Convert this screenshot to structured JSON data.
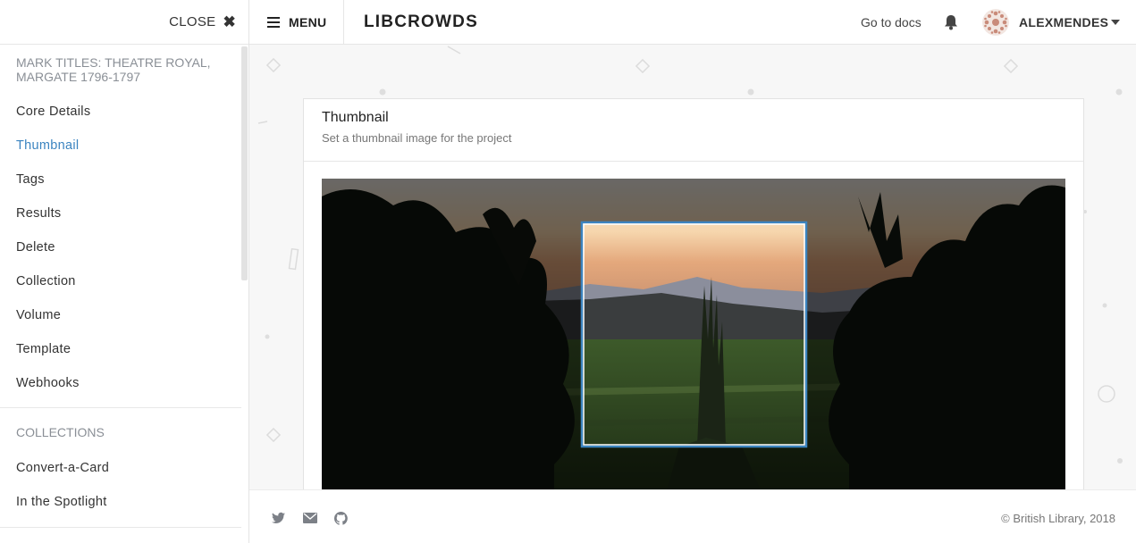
{
  "sidebar": {
    "close_label": "CLOSE",
    "project_title": "MARK TITLES: THEATRE ROYAL, MARGATE 1796-1797",
    "items": [
      {
        "label": "Core Details"
      },
      {
        "label": "Thumbnail"
      },
      {
        "label": "Tags"
      },
      {
        "label": "Results"
      },
      {
        "label": "Delete"
      },
      {
        "label": "Collection"
      },
      {
        "label": "Volume"
      },
      {
        "label": "Template"
      },
      {
        "label": "Webhooks"
      }
    ],
    "active_item": "Thumbnail",
    "collections_heading": "COLLECTIONS",
    "collections": [
      {
        "label": "Convert-a-Card"
      },
      {
        "label": "In the Spotlight"
      }
    ]
  },
  "topbar": {
    "menu_label": "MENU",
    "brand": "LIBCROWDS",
    "docs_link": "Go to docs",
    "username": "ALEXMENDES"
  },
  "card": {
    "title": "Thumbnail",
    "subtitle": "Set a thumbnail image for the project"
  },
  "footer": {
    "copyright": "© British Library, 2018",
    "social_icons": [
      "twitter-icon",
      "mail-icon",
      "github-icon"
    ]
  },
  "colors": {
    "accent": "#3b84c0",
    "muted_text": "#8a8f96",
    "crop_border": "#3b84c0"
  }
}
